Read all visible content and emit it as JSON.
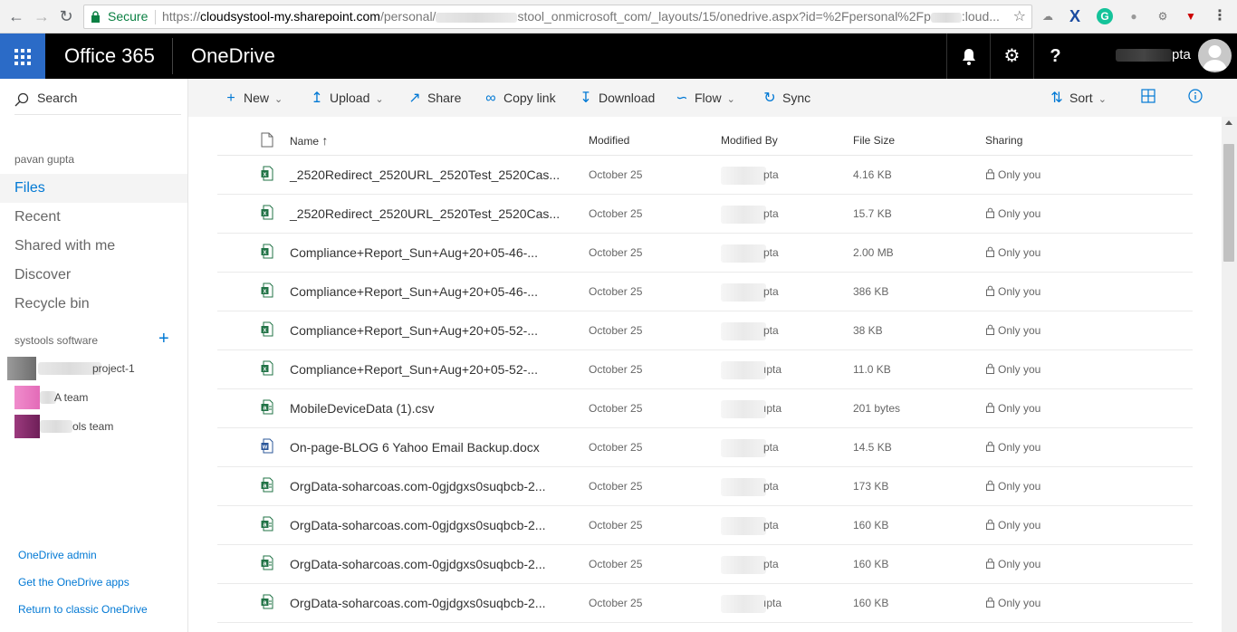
{
  "browser": {
    "secure_label": "Secure",
    "url_prefix": "https://",
    "url_host": "cloudsystool-my.sharepoint.com",
    "url_path1": "/personal/",
    "url_path2": "stool_onmicrosoft_com/_layouts/15/onedrive.aspx?id=%2Fpersonal%2Fp",
    "url_path3": ":loud..."
  },
  "suite": {
    "brand": "Office 365",
    "app": "OneDrive",
    "user_suffix": "pta"
  },
  "leftnav": {
    "search_label": "Search",
    "owner": "pavan gupta",
    "items": [
      {
        "label": "Files",
        "active": true
      },
      {
        "label": "Recent"
      },
      {
        "label": "Shared with me"
      },
      {
        "label": "Discover"
      },
      {
        "label": "Recycle bin"
      }
    ],
    "groups_title": "systools software",
    "groups": [
      {
        "label": "project-1",
        "color": "#7a7a7a"
      },
      {
        "label": "A team",
        "color": "#e36bb8"
      },
      {
        "label": "ols team",
        "color": "#8b2a6e"
      }
    ],
    "footer": [
      "OneDrive admin",
      "Get the OneDrive apps",
      "Return to classic OneDrive"
    ]
  },
  "commands": {
    "new": "New",
    "upload": "Upload",
    "share": "Share",
    "copy_link": "Copy link",
    "download": "Download",
    "flow": "Flow",
    "sync": "Sync",
    "sort": "Sort"
  },
  "list": {
    "headers": {
      "name": "Name",
      "modified": "Modified",
      "modified_by": "Modified By",
      "file_size": "File Size",
      "sharing": "Sharing"
    },
    "rows": [
      {
        "type": "excel",
        "name": "_2520Redirect_2520URL_2520Test_2520Cas...",
        "modified": "October 25",
        "by": "pta",
        "size": "4.16 KB",
        "sharing": "Only you"
      },
      {
        "type": "excel",
        "name": "_2520Redirect_2520URL_2520Test_2520Cas...",
        "modified": "October 25",
        "by": "pta",
        "size": "15.7 KB",
        "sharing": "Only you"
      },
      {
        "type": "excel",
        "name": "Compliance+Report_Sun+Aug+20+05-46-...",
        "modified": "October 25",
        "by": "pta",
        "size": "2.00 MB",
        "sharing": "Only you"
      },
      {
        "type": "excel",
        "name": "Compliance+Report_Sun+Aug+20+05-46-...",
        "modified": "October 25",
        "by": "pta",
        "size": "386 KB",
        "sharing": "Only you"
      },
      {
        "type": "excel",
        "name": "Compliance+Report_Sun+Aug+20+05-52-...",
        "modified": "October 25",
        "by": "pta",
        "size": "38 KB",
        "sharing": "Only you"
      },
      {
        "type": "excel",
        "name": "Compliance+Report_Sun+Aug+20+05-52-...",
        "modified": "October 25",
        "by": "ıpta",
        "size": "11.0 KB",
        "sharing": "Only you"
      },
      {
        "type": "csv",
        "name": "MobileDeviceData (1).csv",
        "modified": "October 25",
        "by": "ıpta",
        "size": "201 bytes",
        "sharing": "Only you"
      },
      {
        "type": "word",
        "name": "On-page-BLOG 6 Yahoo Email Backup.docx",
        "modified": "October 25",
        "by": "pta",
        "size": "14.5 KB",
        "sharing": "Only you"
      },
      {
        "type": "csv",
        "name": "OrgData-soharcoas.com-0gjdgxs0suqbcb-2...",
        "modified": "October 25",
        "by": "pta",
        "size": "173 KB",
        "sharing": "Only you"
      },
      {
        "type": "csv",
        "name": "OrgData-soharcoas.com-0gjdgxs0suqbcb-2...",
        "modified": "October 25",
        "by": "pta",
        "size": "160 KB",
        "sharing": "Only you"
      },
      {
        "type": "csv",
        "name": "OrgData-soharcoas.com-0gjdgxs0suqbcb-2...",
        "modified": "October 25",
        "by": "pta",
        "size": "160 KB",
        "sharing": "Only you"
      },
      {
        "type": "csv",
        "name": "OrgData-soharcoas.com-0gjdgxs0suqbcb-2...",
        "modified": "October 25",
        "by": "ıpta",
        "size": "160 KB",
        "sharing": "Only you"
      }
    ]
  },
  "colors": {
    "accent": "#0078d4",
    "waffle": "#2b6bc7",
    "excel": "#217346",
    "word": "#2b579a",
    "secure": "#0b8043"
  }
}
